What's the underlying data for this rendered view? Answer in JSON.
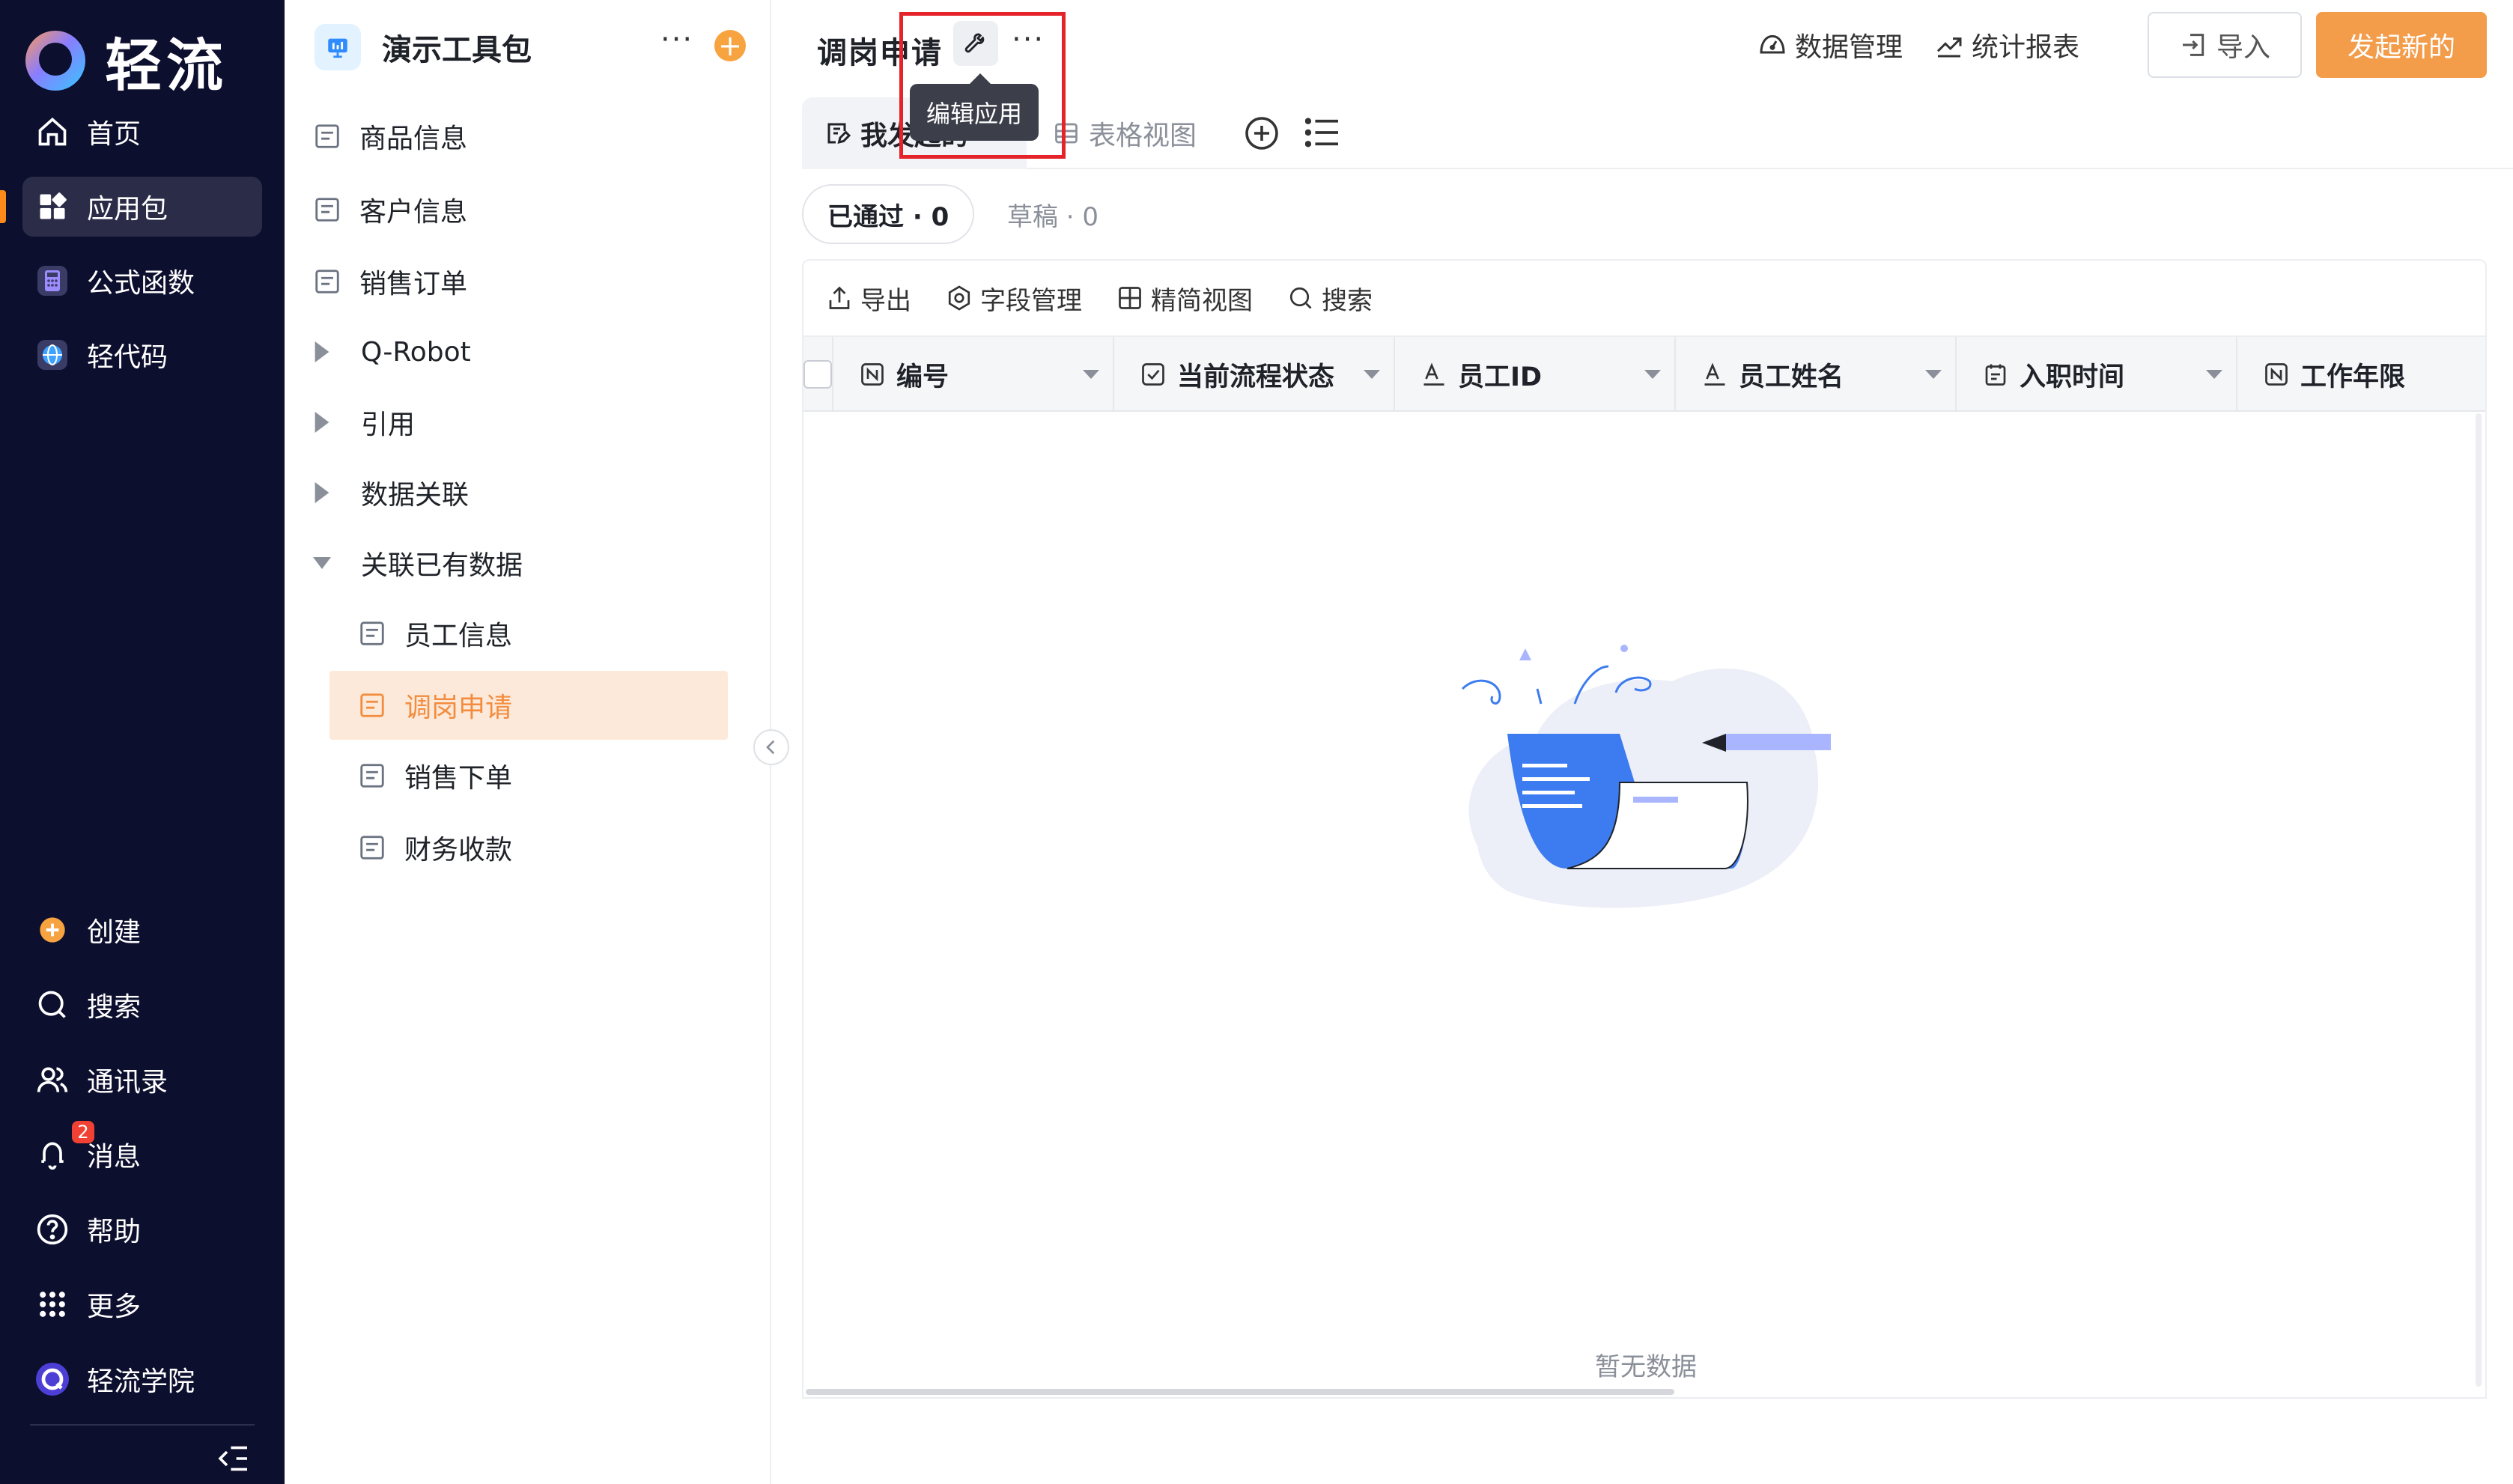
{
  "nav": {
    "logo_text": "轻流",
    "items": [
      {
        "label": "首页",
        "icon": "home-icon"
      },
      {
        "label": "应用包",
        "icon": "apps-icon"
      },
      {
        "label": "公式函数",
        "icon": "formula-icon"
      },
      {
        "label": "轻代码",
        "icon": "globe-code-icon"
      }
    ],
    "bottom": [
      {
        "label": "创建",
        "icon": "plus-circle-icon"
      },
      {
        "label": "搜索",
        "icon": "search-icon"
      },
      {
        "label": "通讯录",
        "icon": "contacts-icon"
      },
      {
        "label": "消息",
        "icon": "bell-icon"
      },
      {
        "label": "帮助",
        "icon": "help-icon"
      },
      {
        "label": "更多",
        "icon": "grid-dots-icon"
      },
      {
        "label": "轻流学院",
        "icon": "academy-icon"
      }
    ],
    "message_badge": "2"
  },
  "panel": {
    "title": "演示工具包",
    "more": "···",
    "add": "+",
    "items": [
      {
        "label": "商品信息",
        "type": "form"
      },
      {
        "label": "客户信息",
        "type": "form"
      },
      {
        "label": "销售订单",
        "type": "form"
      },
      {
        "label": "Q-Robot",
        "type": "folder"
      },
      {
        "label": "引用",
        "type": "folder"
      },
      {
        "label": "数据关联",
        "type": "folder"
      },
      {
        "label": "关联已有数据",
        "type": "folder-open"
      },
      {
        "label": "员工信息",
        "type": "form"
      },
      {
        "label": "调岗申请",
        "type": "form",
        "selected": true
      },
      {
        "label": "销售下单",
        "type": "form"
      },
      {
        "label": "财务收款",
        "type": "form"
      }
    ]
  },
  "main": {
    "title": "调岗申请",
    "title_more": "···",
    "tooltip": "编辑应用",
    "actions": {
      "data_manage": "数据管理",
      "report": "统计报表",
      "import": "导入",
      "start": "发起新的"
    },
    "tabs": [
      {
        "label": "我发起的",
        "active": true
      },
      {
        "label": "表格视图",
        "active": false
      }
    ],
    "filters": {
      "passed": "已通过 · 0",
      "draft": "草稿 · 0"
    },
    "toolbar": {
      "export": "导出",
      "fields": "字段管理",
      "compact": "精简视图",
      "search": "搜索"
    },
    "columns": [
      {
        "label": "编号",
        "icon": "number-field-icon"
      },
      {
        "label": "当前流程状态",
        "icon": "checkbox-field-icon"
      },
      {
        "label": "员工ID",
        "icon": "text-field-icon"
      },
      {
        "label": "员工姓名",
        "icon": "text-field-icon"
      },
      {
        "label": "入职时间",
        "icon": "calendar-field-icon"
      },
      {
        "label": "工作年限",
        "icon": "number-field-icon"
      }
    ],
    "empty_text": "暂无数据"
  },
  "colors": {
    "nav_bg": "#0d0f2e",
    "accent": "#f39c4a",
    "selected_bg": "#fde9d9",
    "selected_text": "#f28d3f",
    "highlight_box": "#e5232a"
  }
}
